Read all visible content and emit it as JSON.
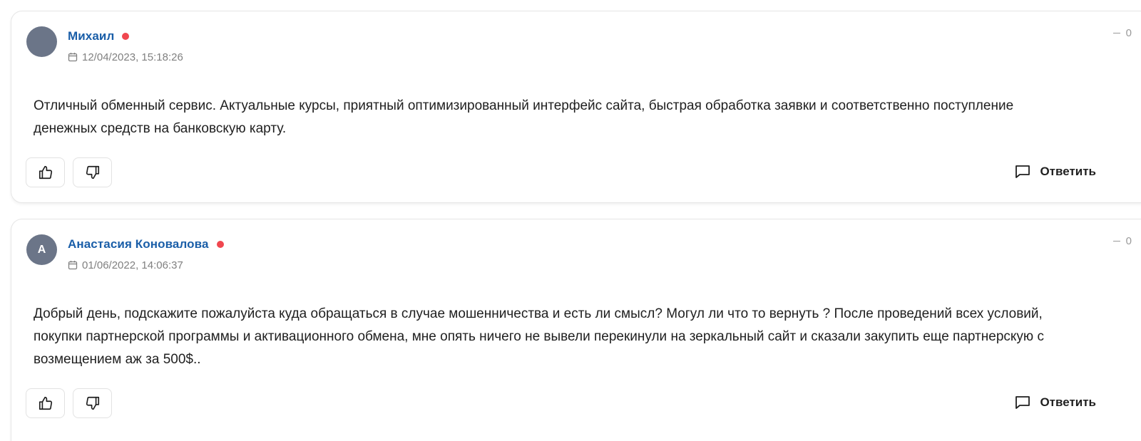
{
  "comments": [
    {
      "author": "Михаил",
      "avatar_letter": "",
      "date": "12/04/2023, 15:18:26",
      "rating": "0",
      "text": "Отличный обменный сервис. Актуальные курсы, приятный оптимизированный интерфейс сайта, быстрая обработка заявки и соответственно поступление денежных средств на банковскую карту.",
      "reply_label": "Ответить"
    },
    {
      "author": "Анастасия Коновалова",
      "avatar_letter": "А",
      "date": "01/06/2022, 14:06:37",
      "rating": "0",
      "text": "Добрый день, подскажите пожалуйста куда обращаться в случае мошенничества и есть ли смысл? Могул ли что то вернуть ? После проведений всех условий, покупки партнерской программы и активационного обмена, мне опять ничего не вывели перекинули на зеркальный сайт и сказали закупить еще партнерскую с возмещением аж за 500$..",
      "reply_label": "Ответить"
    }
  ],
  "icons": {
    "date": "calendar-icon",
    "like": "thumbs-up-icon",
    "dislike": "thumbs-down-icon",
    "reply": "chat-bubble-icon",
    "status": "online-dot"
  },
  "colors": {
    "author_name": "#1a5ea8",
    "online_dot": "#f0474f",
    "avatar_bg": "#6b7588",
    "date_text": "#808080"
  }
}
